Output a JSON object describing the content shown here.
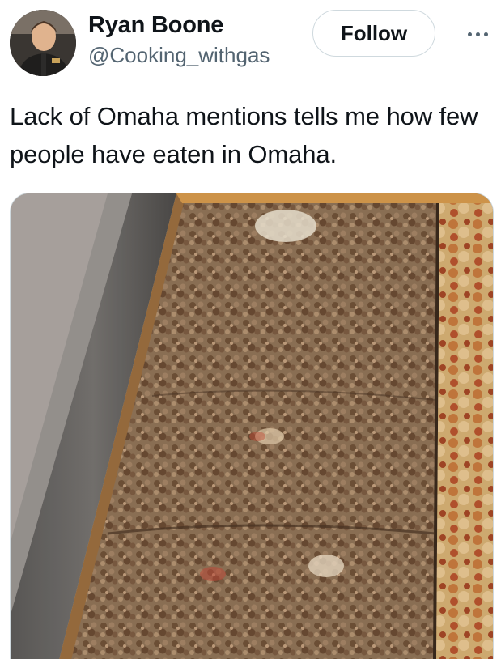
{
  "tweet": {
    "author": {
      "display_name": "Ryan Boone",
      "handle": "@Cooking_withgas"
    },
    "follow_label": "Follow",
    "text": "Lack of Omaha mentions tells me how few people have eaten in Omaha.",
    "media": {
      "subject": "rectangular pan pizza topped with crumbled sausage"
    }
  },
  "icons": {
    "more": "more-horizontal-icon"
  },
  "colors": {
    "text_primary": "#0f1419",
    "text_secondary": "#536471",
    "border": "#cfd9de"
  }
}
